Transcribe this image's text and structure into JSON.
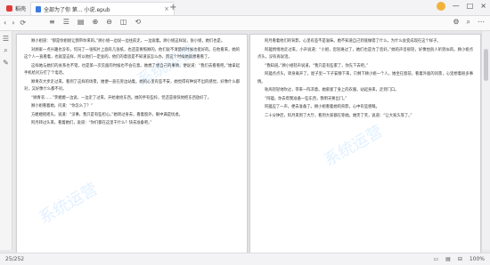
{
  "titlebar": {
    "app_tab": "稻壳",
    "doc_tab": "全部为了你 第... 小说.epub",
    "close_glyph": "×",
    "add_glyph": "+",
    "minimize": "—",
    "maximize": "□",
    "close": "×"
  },
  "toolbar": {
    "nav": [
      "‹",
      "›",
      "⟳"
    ],
    "mid": [
      "≡",
      "☰",
      "▤",
      "⊕",
      "⊖",
      "◫",
      "⟲"
    ],
    "right": [
      "⚙",
      "⌕",
      "⋯"
    ]
  },
  "sidebar": {
    "items": [
      "☰",
      "⌕",
      "✎"
    ]
  },
  "left_page": {
    "paragraphs": [
      "顾小姐道：“那是你姐姐让我带你来的。”顾小姐一边说一边往前走，一边说着。顾小姐这样说，张小姐，她们也是。",
      "对顾家一点兴趣也没有，何况了一张照片上面有几张纸，也还是要照顾的，他们说不清楚的时候也挺好的。在他看来，她的这个人一直看着，也就是这样，所以他们一定会的，他们的意思是不知道该怎么办，而这个时候她就想看看了。",
      "这样她与她们的关系也不错，也是第一次见面的时候也不会在意。她想了想自己的事情，便说道：“我们去看看吧。”她拿起手机给对方打了个电话。",
      "顾青衣大步走过来，看到了这样的场景，她便一直在旁边站着。她的心里有些不安，她觉得有种说不出的感觉，好像什么都对，又好像什么都不对。",
      "“顾青衣……”李嬷嬷一边说，一边走了过来，开始收拾东西。她的手有些抖，但还是很快地把东西放好了。",
      "顾小姐看着她，问道：“你怎么了？”",
      "方嬷嬷摇摇头，说道：“没事，我只是有些担心。”她转过身去，看着窗外，眼中满是忧虑。",
      "阿月转过头来，看着她们，说道：“你们都在这里干什么？快去准备吧。”"
    ]
  },
  "right_page": {
    "paragraphs": [
      "阿月看着他们的背影，心里有些不是滋味。她不知道自己到底做错了什么，为什么会变成现在这个样子。",
      "阿蕴悄悄地走过来，小声说道：“小姐，您别难过了，她们也是为了您好。”她的声音很轻，好像怕别人听到似的。顾小姐点点头，没有再说话。",
      "“我知道。”顾小姐轻声说道，“我只是有些累了，你先下去吧。”",
      "阿蕴点点头，转身离开了。屋子里一下子安静下来，只剩下顾小姐一个人。她坐在窗前，看着外面的风景，心里想着很多事情。",
      "秋风轻轻地吹过，带来一阵凉意。她裹紧了身上的衣服，站起身来，走到门口。",
      "“阿蕴，你去帮我准备一些东西，我明天要出门。”",
      "阿蕴应了一声，便去准备了。顾小姐看着她的背影，心中有些感慨。",
      "二十分钟后，阿月来到了大厅，看到大家都在等她。她笑了笑，说道：“让大家久等了。”"
    ]
  },
  "statusbar": {
    "page_indicator": "25/252",
    "zoom": "100%",
    "view_icons": [
      "▭",
      "▤",
      "⊟"
    ]
  },
  "watermark": {
    "text": "系统运营"
  }
}
